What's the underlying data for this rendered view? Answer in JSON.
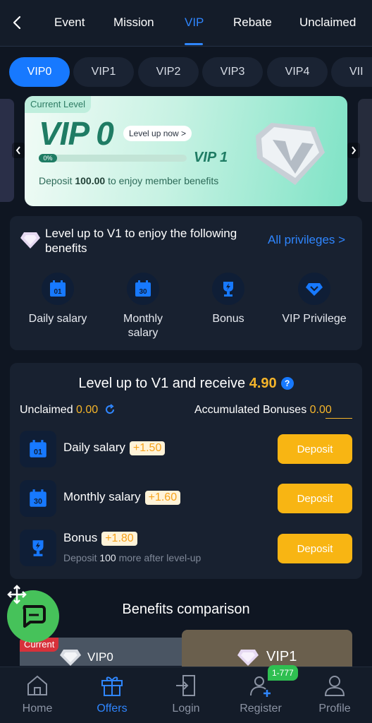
{
  "nav": {
    "tabs": [
      {
        "label": "Event"
      },
      {
        "label": "Mission"
      },
      {
        "label": "VIP"
      },
      {
        "label": "Rebate"
      },
      {
        "label": "Unclaimed"
      }
    ],
    "active_tab": "VIP",
    "accent": "#2f86ff"
  },
  "levels": [
    "VIP0",
    "VIP1",
    "VIP2",
    "VIP3",
    "VIP4",
    "VII"
  ],
  "card": {
    "tag": "Current Level",
    "level": "VIP 0",
    "level_up": "Level up now >",
    "progress": "0%",
    "progress_value": 0,
    "next": "VIP 1",
    "deposit_prefix": "Deposit ",
    "deposit_amount": "100.00",
    "deposit_suffix": " to enjoy member benefits"
  },
  "benefits": {
    "title": "Level up to V1 to enjoy the following benefits",
    "all_link": "All privileges >",
    "items": [
      {
        "label": "Daily salary",
        "icon": "calendar-01-icon"
      },
      {
        "label": "Monthly salary",
        "icon": "calendar-30-icon"
      },
      {
        "label": "Bonus",
        "icon": "trophy-icon"
      },
      {
        "label": "VIP Privilege",
        "icon": "diamond-icon"
      }
    ]
  },
  "levelup": {
    "title_prefix": "Level up to V1 and receive ",
    "title_amount": "4.90",
    "unclaimed_label": "Unclaimed ",
    "unclaimed_value": "0.00",
    "accumulated_label": "Accumulated Bonuses ",
    "accumulated_value": "0.00",
    "items": [
      {
        "name": "Daily salary",
        "bonus": "+1.50",
        "button": "Deposit"
      },
      {
        "name": "Monthly salary",
        "bonus": "+1.60",
        "button": "Deposit"
      },
      {
        "name": "Bonus",
        "bonus": "+1.80",
        "button": "Deposit",
        "sub_prefix": "Deposit ",
        "sub_amount": "100",
        "sub_suffix": " more after level-up"
      }
    ]
  },
  "comparison": {
    "title": "Benefits comparison",
    "current_tag": "Current",
    "left_level": "VIP0",
    "right_level": "VIP1"
  },
  "bottom_nav": {
    "items": [
      {
        "label": "Home"
      },
      {
        "label": "Offers"
      },
      {
        "label": "Login"
      },
      {
        "label": "Register"
      },
      {
        "label": "Profile"
      }
    ],
    "register_badge": "1-777",
    "active": "Offers"
  },
  "colors": {
    "background": "#0f1622",
    "gold": "#f5b52a",
    "deposit_button": "#f8b513",
    "chat": "#46c25a"
  }
}
